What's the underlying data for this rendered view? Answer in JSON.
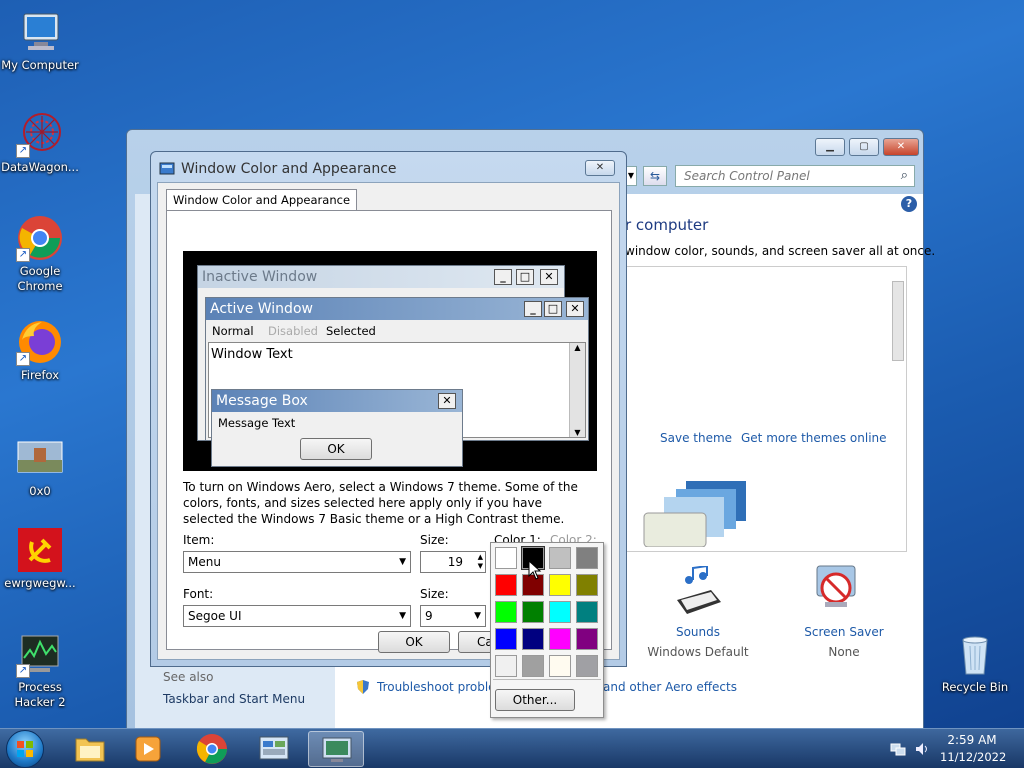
{
  "desktop": {
    "icons": [
      {
        "label": "My Computer"
      },
      {
        "label": "DataWagon..."
      },
      {
        "label": "Google Chrome"
      },
      {
        "label": "Firefox"
      },
      {
        "label": "0x0"
      },
      {
        "label": "ewrgwegw..."
      },
      {
        "label": "Process Hacker 2"
      },
      {
        "label": "Recycle Bin"
      }
    ]
  },
  "control_panel": {
    "search_placeholder": "Search Control Panel",
    "heading": "r computer",
    "subtext": "window color, sounds, and screen saver all at once.",
    "save_theme": "Save theme",
    "get_more_themes": "Get more themes online",
    "sounds_label": "Sounds",
    "sounds_value": "Windows Default",
    "screensaver_label": "Screen Saver",
    "screensaver_value": "None",
    "see_also": "See also",
    "taskbar_link": "Taskbar and Start Menu",
    "troubleshoot": "Troubleshoot probler",
    "aero_effects": "and other Aero effects"
  },
  "dialog": {
    "title": "Window Color and Appearance",
    "tab": "Window Color and Appearance",
    "preview": {
      "inactive_window": "Inactive Window",
      "active_window": "Active Window",
      "menu_normal": "Normal",
      "menu_disabled": "Disabled",
      "menu_selected": "Selected",
      "window_text": "Window Text",
      "message_box": "Message Box",
      "message_text": "Message Text",
      "ok": "OK"
    },
    "description": "To turn on Windows Aero, select a Windows 7 theme.  Some of the colors, fonts, and sizes selected here apply only if you have selected the Windows 7 Basic theme or a High Contrast theme.",
    "item_label": "Item:",
    "item_value": "Menu",
    "size_label": "Size:",
    "size_value": "19",
    "color1_label": "Color 1:",
    "color2_label": "Color 2:",
    "font_label": "Font:",
    "font_value": "Segoe UI",
    "font_size_label": "Size:",
    "font_size_value": "9",
    "ok_button": "OK",
    "cancel_button": "Ca"
  },
  "color_popup": {
    "other_button": "Other...",
    "swatches": [
      "#ffffff",
      "#000000",
      "#c0c0c0",
      "#808080",
      "#ff0000",
      "#800000",
      "#ffff00",
      "#808000",
      "#00ff00",
      "#008000",
      "#00ffff",
      "#008080",
      "#0000ff",
      "#000080",
      "#ff00ff",
      "#800080",
      "#f0f0f0",
      "#a0a0a0",
      "#fffbf0",
      "#a0a0a4"
    ]
  },
  "taskbar": {
    "time": "2:59 AM",
    "date": "11/12/2022"
  }
}
